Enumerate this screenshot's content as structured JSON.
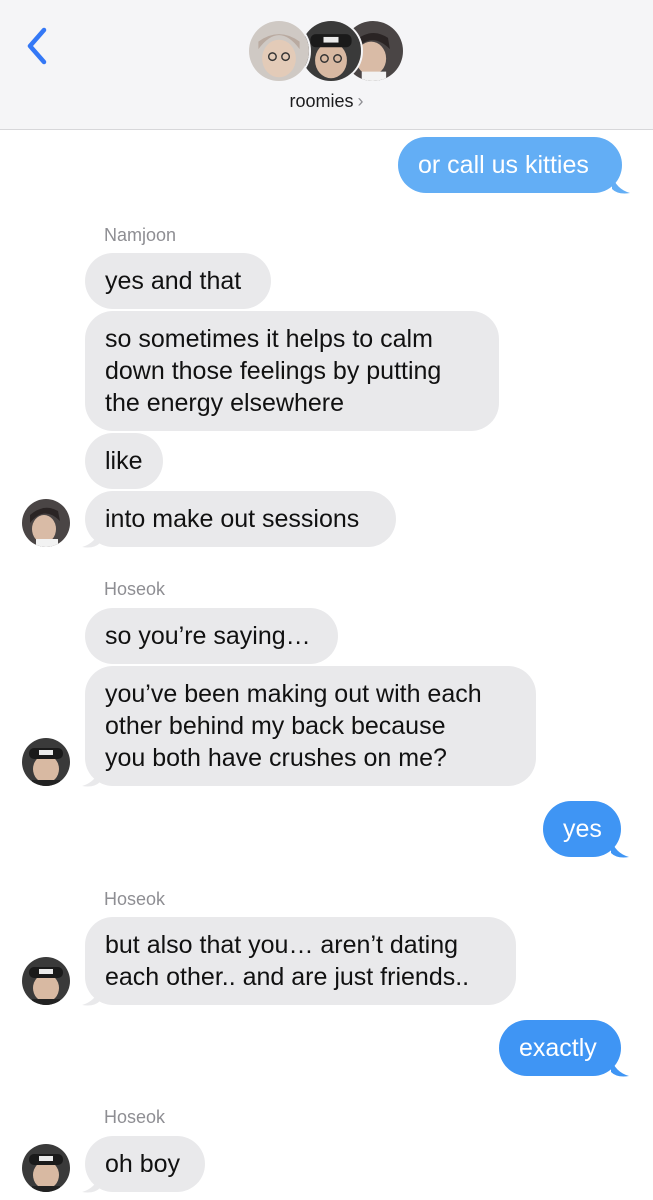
{
  "header": {
    "group_name": "roomies",
    "chevron": "›",
    "back_icon": "chevron-left-icon",
    "accent": "#3478f6"
  },
  "messages": [
    {
      "side": "out",
      "text": "or call us kitties"
    },
    {
      "sender": "Namjoon"
    },
    {
      "side": "in",
      "text": "yes and that"
    },
    {
      "side": "in",
      "lines": [
        "so sometimes it helps to calm",
        "down those feelings by putting",
        "the energy elsewhere"
      ]
    },
    {
      "side": "in",
      "text": "like"
    },
    {
      "side": "in",
      "text": "into make out sessions"
    },
    {
      "sender": "Hoseok"
    },
    {
      "side": "in",
      "text": "so you’re saying…"
    },
    {
      "side": "in",
      "lines": [
        "you’ve been making out with each",
        "other behind my back because",
        "you both have crushes on me?"
      ]
    },
    {
      "side": "out",
      "text": "yes"
    },
    {
      "sender": "Hoseok"
    },
    {
      "side": "in",
      "lines": [
        "but also that you… aren’t dating",
        "each other.. and are just friends.."
      ]
    },
    {
      "side": "out",
      "text": "exactly"
    },
    {
      "sender": "Hoseok"
    },
    {
      "side": "in",
      "text": "oh boy"
    }
  ],
  "colors": {
    "outgoing_bubble": "#3f95f4",
    "incoming_bubble": "#e9e9eb",
    "sender_label": "#8e8e93"
  }
}
